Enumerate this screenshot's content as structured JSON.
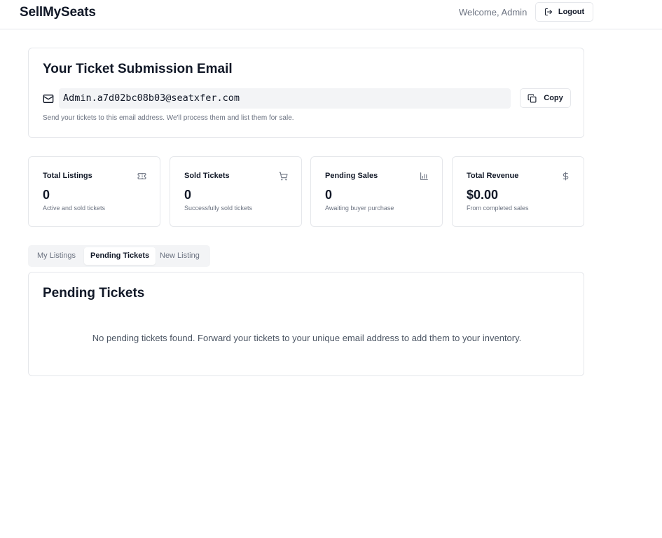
{
  "header": {
    "brand": "SellMySeats",
    "welcome": "Welcome, Admin",
    "logout_label": "Logout"
  },
  "email_card": {
    "title": "Your Ticket Submission Email",
    "email": "Admin.a7d02bc08b03@seatxfer.com",
    "copy_label": "Copy",
    "help": "Send your tickets to this email address. We'll process them and list them for sale."
  },
  "stats": [
    {
      "title": "Total Listings",
      "value": "0",
      "subtitle": "Active and sold tickets",
      "icon": "ticket-icon"
    },
    {
      "title": "Sold Tickets",
      "value": "0",
      "subtitle": "Successfully sold tickets",
      "icon": "cart-icon"
    },
    {
      "title": "Pending Sales",
      "value": "0",
      "subtitle": "Awaiting buyer purchase",
      "icon": "bar-chart-icon"
    },
    {
      "title": "Total Revenue",
      "value": "$0.00",
      "subtitle": "From completed sales",
      "icon": "dollar-icon"
    }
  ],
  "tabs": [
    {
      "label": "My Listings",
      "active": false
    },
    {
      "label": "Pending Tickets",
      "active": true
    },
    {
      "label": "New Listing",
      "active": false
    }
  ],
  "pending": {
    "title": "Pending Tickets",
    "empty_message": "No pending tickets found. Forward your tickets to your unique email address to add them to your inventory."
  },
  "colors": {
    "text": "#111827",
    "muted": "#6b7280",
    "border": "#e5e7eb",
    "surface_muted": "#f3f4f6"
  }
}
